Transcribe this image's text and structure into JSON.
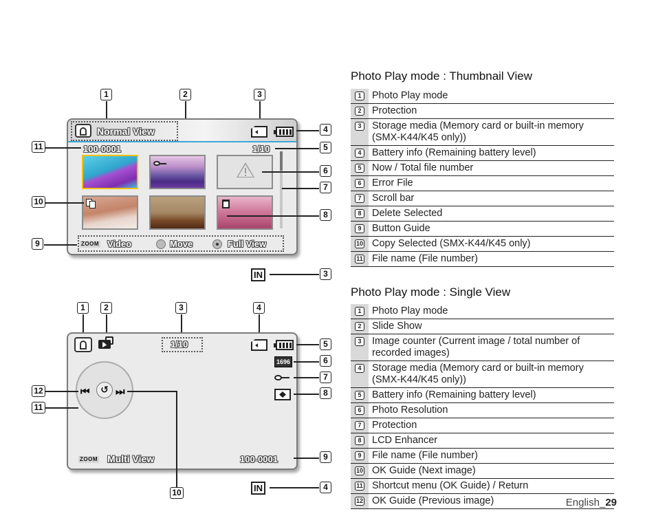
{
  "thumbnail_screen": {
    "mode_label": "Normal View",
    "file_name": "100-0001",
    "counter": "1/10",
    "guide": {
      "zoom_tag": "ZOOM",
      "video_label": "Video",
      "move_label": "Move",
      "full_view_label": "Full View"
    },
    "internal_memory_icon": "IN",
    "callouts": [
      "1",
      "2",
      "3",
      "4",
      "5",
      "6",
      "7",
      "8",
      "9",
      "10",
      "11",
      "3"
    ],
    "thumbnails": [
      {
        "name": "pool-float",
        "colors": [
          "#3fb9d9",
          "#9b3fc4"
        ],
        "selected": true
      },
      {
        "name": "purple-mountains",
        "colors": [
          "#c7a2d4",
          "#5e3a8c"
        ],
        "protected": true
      },
      {
        "name": "error-file",
        "error": true
      },
      {
        "name": "sand-dunes",
        "colors": [
          "#c9957b",
          "#e9ddd6"
        ],
        "copy": true
      },
      {
        "name": "hiker",
        "colors": [
          "#a3876b",
          "#6a3d21"
        ]
      },
      {
        "name": "pink-forest",
        "colors": [
          "#d68aa6",
          "#a3385c"
        ],
        "delete": true
      }
    ]
  },
  "single_screen": {
    "counter": "1/10",
    "zoom_tag": "ZOOM",
    "multi_view_label": "Multi View",
    "file_name": "100-0001",
    "resolution_icon": "1696",
    "internal_memory_icon": "IN",
    "callouts": [
      "1",
      "2",
      "3",
      "4",
      "5",
      "6",
      "7",
      "8",
      "9",
      "10",
      "11",
      "12",
      "4"
    ]
  },
  "thumbnail_table": {
    "title": "Photo Play mode : Thumbnail View",
    "rows": [
      {
        "n": "1",
        "text": "Photo Play mode"
      },
      {
        "n": "2",
        "text": "Protection"
      },
      {
        "n": "3",
        "text": "Storage media (Memory card or built-in memory (SMX-K44/K45 only))"
      },
      {
        "n": "4",
        "text": "Battery info (Remaining battery level)"
      },
      {
        "n": "5",
        "text": "Now / Total file number"
      },
      {
        "n": "6",
        "text": "Error File"
      },
      {
        "n": "7",
        "text": "Scroll bar"
      },
      {
        "n": "8",
        "text": "Delete Selected"
      },
      {
        "n": "9",
        "text": "Button Guide"
      },
      {
        "n": "10",
        "text": "Copy Selected (SMX-K44/K45 only)"
      },
      {
        "n": "11",
        "text": "File name (File number)"
      }
    ]
  },
  "single_table": {
    "title": "Photo Play mode : Single View",
    "rows": [
      {
        "n": "1",
        "text": "Photo Play mode"
      },
      {
        "n": "2",
        "text": "Slide Show"
      },
      {
        "n": "3",
        "text": "Image counter (Current image / total number of recorded images)"
      },
      {
        "n": "4",
        "text": "Storage media (Memory card or built-in memory (SMX-K44/K45 only))"
      },
      {
        "n": "5",
        "text": "Battery info (Remaining battery level)"
      },
      {
        "n": "6",
        "text": "Photo Resolution"
      },
      {
        "n": "7",
        "text": "Protection"
      },
      {
        "n": "8",
        "text": "LCD Enhancer"
      },
      {
        "n": "9",
        "text": "File name (File number)"
      },
      {
        "n": "10",
        "text": "OK Guide (Next image)"
      },
      {
        "n": "11",
        "text": "Shortcut menu (OK Guide) / Return"
      },
      {
        "n": "12",
        "text": "OK Guide (Previous image)"
      }
    ]
  },
  "footer": {
    "language": "English_",
    "page": "29"
  },
  "colors": {
    "header_line": "#3aa7d6",
    "selection": "#f2c200",
    "lcd_bg": "#ebebeb",
    "table_index_bg": "#d9d9d9"
  }
}
